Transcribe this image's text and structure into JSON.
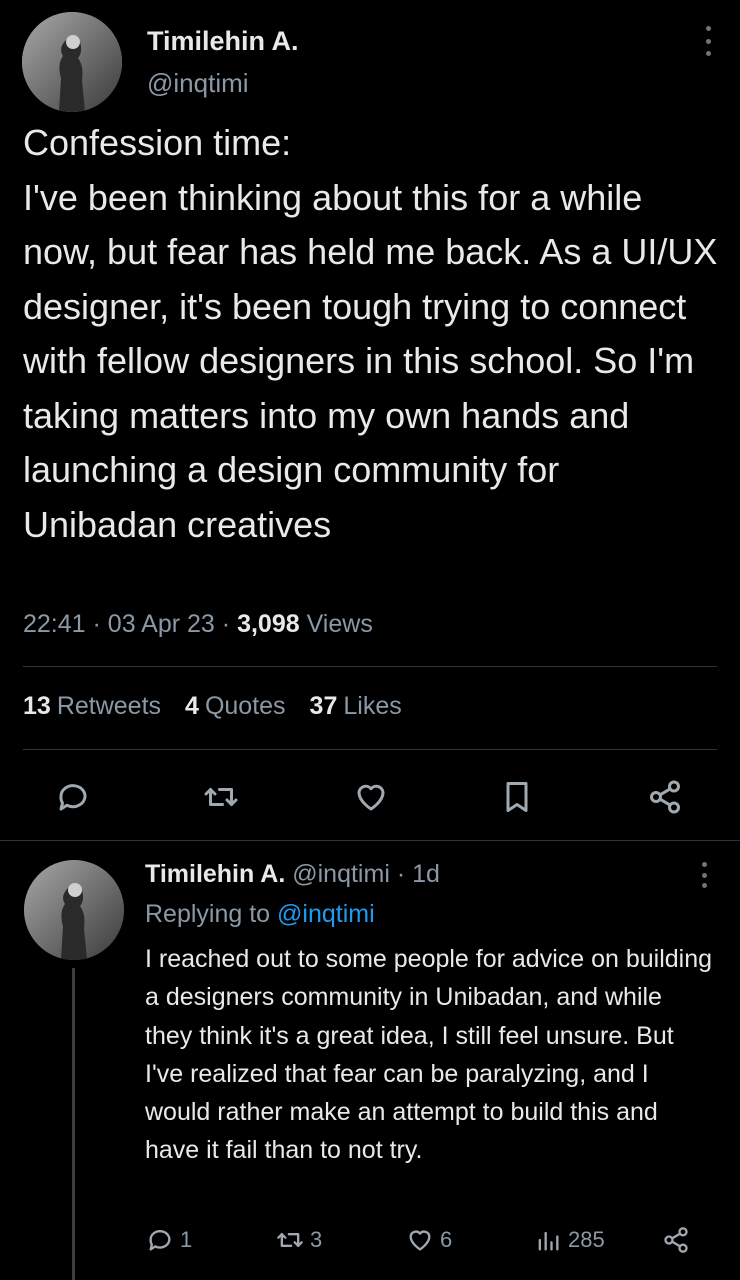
{
  "tweet": {
    "author_name": "Timilehin A.",
    "author_handle": "@inqtimi",
    "text": "Confession time:\nI've been thinking about this for a while now, but fear has held me back. As a UI/UX designer, it's been tough trying to connect with fellow designers in this school. So I'm taking matters into my own hands and launching a design community for Unibadan creatives",
    "time": "22:41",
    "date": "03 Apr 23",
    "views_count": "3,098",
    "views_label": "Views",
    "retweets_count": "13",
    "retweets_label": "Retweets",
    "quotes_count": "4",
    "quotes_label": "Quotes",
    "likes_count": "37",
    "likes_label": "Likes"
  },
  "actions": {
    "icons": [
      "reply-icon",
      "retweet-icon",
      "like-icon",
      "bookmark-icon",
      "share-icon"
    ]
  },
  "reply": {
    "author_name": "Timilehin A.",
    "author_handle": "@inqtimi",
    "age": "1d",
    "replying_label": "Replying to",
    "replying_mention": "@inqtimi",
    "text": "I reached out to some people for advice on building a designers community in Unibadan, and while they think it's a great idea, I still feel unsure. But I've realized that fear can be paralyzing, and I would rather make an attempt to build this and have it fail than to not try.",
    "reply_count": "1",
    "retweet_count": "3",
    "like_count": "6",
    "view_count": "285"
  },
  "colors": {
    "background": "#000000",
    "text": "#e7e9ea",
    "muted": "#8b98a5",
    "accent": "#1d9bf0",
    "divider": "#2f3336"
  }
}
